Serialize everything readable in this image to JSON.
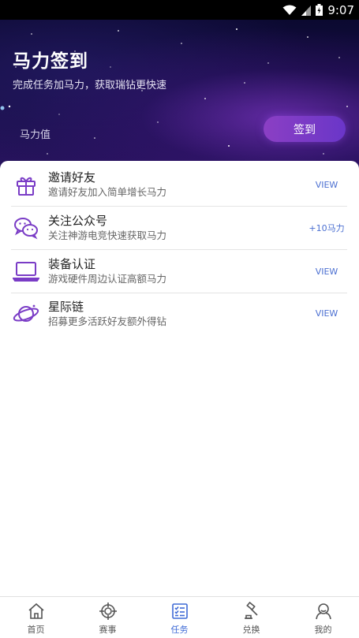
{
  "status_bar": {
    "time": "9:07"
  },
  "hero": {
    "title": "马力签到",
    "subtitle": "完成任务加马力，获取瑞钻更快速",
    "horsepower_label": "马力值",
    "checkin_label": "签到"
  },
  "tasks": [
    {
      "icon": "gift-icon",
      "title": "邀请好友",
      "desc": "邀请好友加入简单增长马力",
      "action": "VIEW"
    },
    {
      "icon": "wechat-icon",
      "title": "关注公众号",
      "desc": "关注神游电竞快速获取马力",
      "action": "+10马力"
    },
    {
      "icon": "laptop-icon",
      "title": "装备认证",
      "desc": "游戏硬件周边认证高额马力",
      "action": "VIEW"
    },
    {
      "icon": "planet-icon",
      "title": "星际链",
      "desc": "招募更多活跃好友额外得钻",
      "action": "VIEW"
    }
  ],
  "nav": [
    {
      "icon": "home-icon",
      "label": "首页"
    },
    {
      "icon": "crosshair-icon",
      "label": "赛事"
    },
    {
      "icon": "checklist-icon",
      "label": "任务",
      "active": true
    },
    {
      "icon": "gavel-icon",
      "label": "兑换"
    },
    {
      "icon": "user-icon",
      "label": "我的"
    }
  ],
  "colors": {
    "accent": "#7a3cc6",
    "nav_active": "#3f6bd6",
    "action_link": "#4b6fd1"
  }
}
